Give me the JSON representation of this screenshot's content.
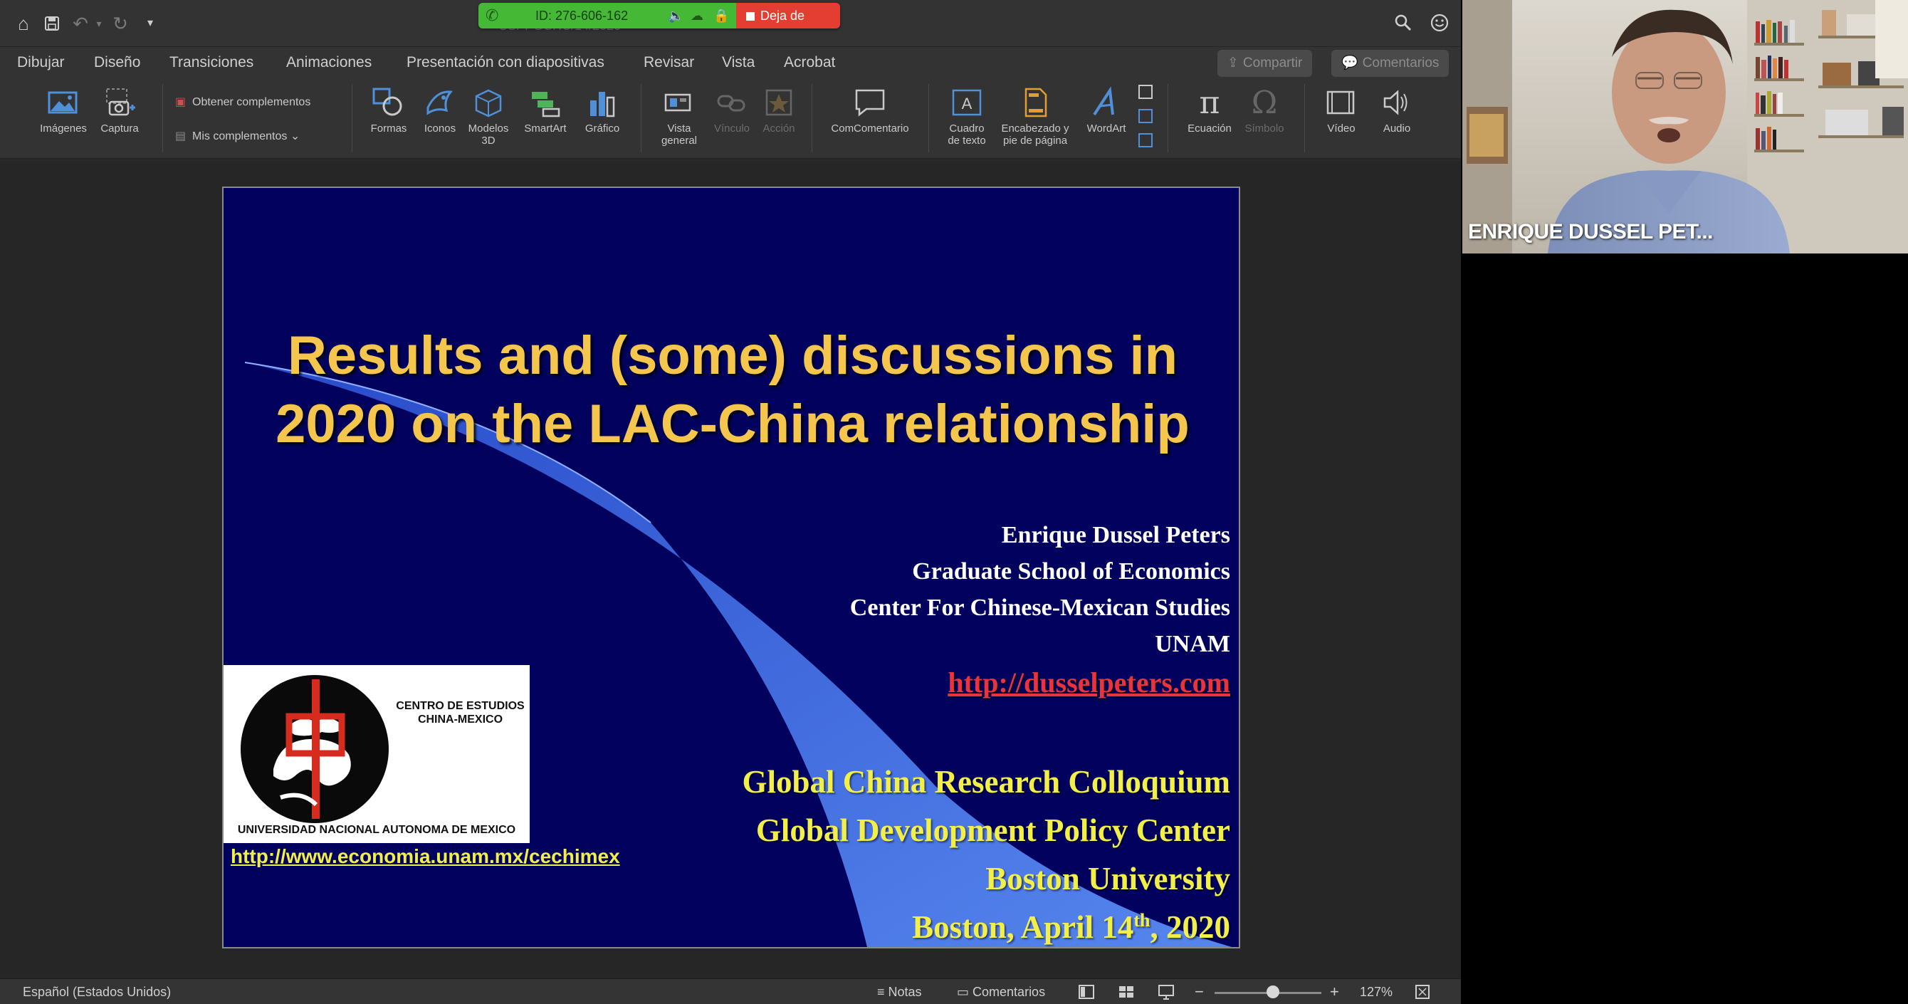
{
  "window": {
    "session_id": "ID: 276-606-162",
    "stop_share_label": "Deja de",
    "doc_title_partial": "CSPPGCRC/14/2020"
  },
  "menu": {
    "items": [
      "Dibujar",
      "Diseño",
      "Transiciones",
      "Animaciones",
      "Presentación con diapositivas",
      "Revisar",
      "Vista",
      "Acrobat"
    ],
    "share_label": "Compartir",
    "comments_label": "Comentarios"
  },
  "ribbon": {
    "images": "Imágenes",
    "capture": "Captura",
    "get_addins": "Obtener complementos",
    "my_addins": "Mis complementos",
    "shapes": "Formas",
    "icons": "Iconos",
    "models3d_l1": "Modelos",
    "models3d_l2": "3D",
    "smartart": "SmartArt",
    "chart": "Gráfico",
    "overview_l1": "Vista",
    "overview_l2": "general",
    "link": "Vínculo",
    "action": "Acción",
    "comment": "ComComentario",
    "textbox_l1": "Cuadro",
    "textbox_l2": "de texto",
    "headerfooter_l1": "Encabezado y",
    "headerfooter_l2": "pie de página",
    "wordart": "WordArt",
    "equation": "Ecuación",
    "symbol": "Símbolo",
    "video": "Vídeo",
    "audio": "Audio"
  },
  "slide": {
    "title_line1": "Results and (some) discussions in",
    "title_line2": "2020 on the LAC-China relationship",
    "author": "Enrique Dussel Peters",
    "school": "Graduate School of Economics",
    "center": "Center For Chinese-Mexican Studies",
    "university": "UNAM",
    "website": "http://dusselpeters.com",
    "event1": "Global China Research Colloquium",
    "event2": "Global Development Policy Center",
    "event3": "Boston University",
    "date_prefix": "Boston, April 14",
    "date_sup": "th",
    "date_suffix": ", 2020",
    "logo_center_l1": "CENTRO DE ESTUDIOS",
    "logo_center_l2": "CHINA-MEXICO",
    "logo_university": "UNIVERSIDAD NACIONAL AUTONOMA DE MEXICO",
    "logo_url": "http://www.economia.unam.mx/cechimex"
  },
  "statusbar": {
    "language": "Español (Estados Unidos)",
    "notes": "Notas",
    "comments": "Comentarios",
    "zoom": "127%"
  },
  "video": {
    "participant_name": "ENRIQUE DUSSEL PET..."
  },
  "colors": {
    "slide_bg": "#02025e",
    "title": "#f5c64e",
    "event_text": "#f3ef49",
    "link_red": "#e8343a",
    "share_green": "#45b935",
    "stop_red": "#e43e32"
  }
}
